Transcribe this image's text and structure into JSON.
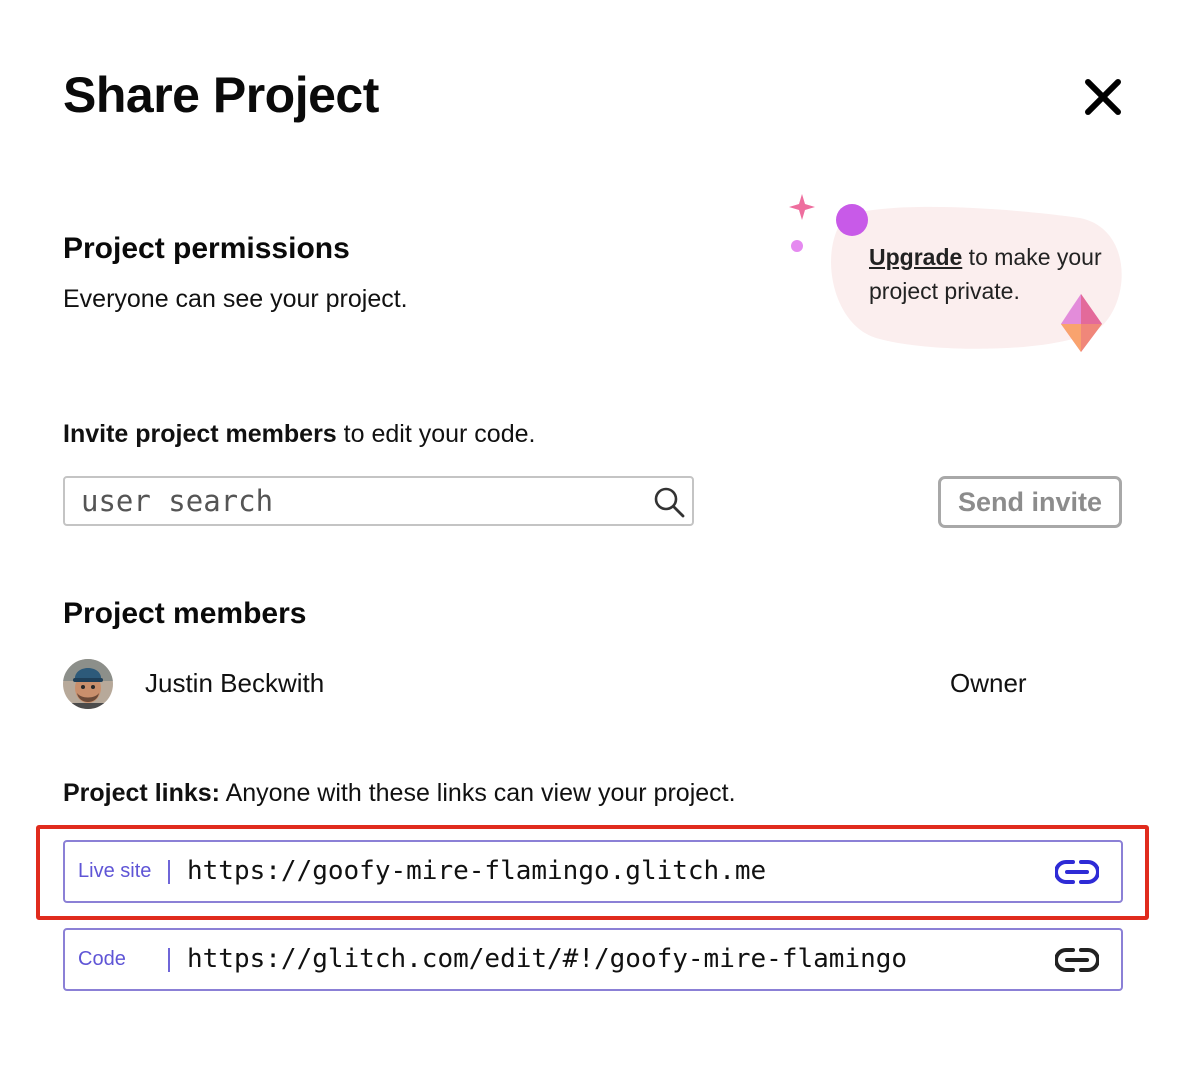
{
  "dialog": {
    "title": "Share Project",
    "close_icon": "close-icon"
  },
  "permissions": {
    "heading": "Project permissions",
    "description": "Everyone can see your project.",
    "upgrade_link": "Upgrade",
    "upgrade_rest": " to make your project private."
  },
  "invite": {
    "heading_bold": "Invite project members",
    "heading_rest": " to edit your code.",
    "search_placeholder": "user search",
    "search_value": "",
    "search_icon": "search-icon",
    "send_button": "Send invite"
  },
  "members": {
    "heading": "Project members",
    "list": [
      {
        "name": "Justin Beckwith",
        "role": "Owner",
        "avatar_icon": "avatar-photo"
      }
    ]
  },
  "links": {
    "heading_bold": "Project links:",
    "heading_rest": " Anyone with these links can view your project.",
    "items": [
      {
        "label": "Live site",
        "url": "https://goofy-mire-flamingo.glitch.me",
        "icon": "link-icon",
        "icon_color": "#2e2bd6"
      },
      {
        "label": "Code",
        "url": "https://glitch.com/edit/#!/goofy-mire-flamingo",
        "icon": "link-icon",
        "icon_color": "#222222"
      }
    ]
  },
  "colors": {
    "highlight": "#e02b1d",
    "link_border": "#8b80d6",
    "link_label": "#5f55d6",
    "upgrade_blob": "#fbeeee",
    "sparkle_pink": "#ee6e9e",
    "sparkle_purple": "#c85ae8"
  }
}
